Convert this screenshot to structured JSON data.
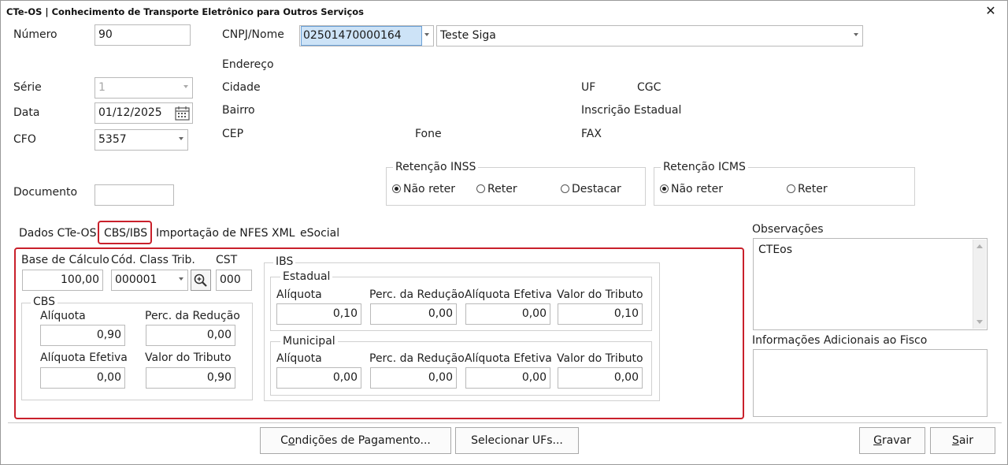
{
  "window": {
    "title": "CTe-OS | Conhecimento de Transporte Eletrônico para Outros Serviços",
    "close": "✕"
  },
  "header": {
    "numero_label": "Número",
    "numero_value": "90",
    "serie_label": "Série",
    "serie_value": "1",
    "data_label": "Data",
    "data_value": "01/12/2025",
    "cfo_label": "CFO",
    "cfo_value": "5357",
    "documento_label": "Documento",
    "documento_value": "",
    "cnpj_label": "CNPJ/Nome",
    "cnpj_value": "02501470000164",
    "nome_value": "Teste Siga",
    "endereco_label": "Endereço",
    "cidade_label": "Cidade",
    "bairro_label": "Bairro",
    "cep_label": "CEP",
    "fone_label": "Fone",
    "uf_label": "UF",
    "cgc_label": "CGC",
    "ie_label": "Inscrição Estadual",
    "fax_label": "FAX"
  },
  "retencao_inss": {
    "title": "Retenção INSS",
    "options": [
      "Não reter",
      "Reter",
      "Destacar"
    ],
    "selected": "Não reter"
  },
  "retencao_icms": {
    "title": "Retenção ICMS",
    "options": [
      "Não reter",
      "Reter"
    ],
    "selected": "Não reter"
  },
  "tabs": [
    "Dados CTe-OS",
    "CBS/IBS",
    "Importação de NFES XML",
    "eSocial"
  ],
  "active_tab": "CBS/IBS",
  "cbs_ibs": {
    "base_calculo_label": "Base de Cálculo",
    "base_calculo_value": "100,00",
    "cod_class_label": "Cód. Class Trib.",
    "cod_class_value": "000001",
    "cst_label": "CST",
    "cst_value": "000",
    "cbs": {
      "title": "CBS",
      "aliquota_label": "Alíquota",
      "aliquota_value": "0,90",
      "perc_reducao_label": "Perc. da Redução",
      "perc_reducao_value": "0,00",
      "aliquota_efetiva_label": "Alíquota Efetiva",
      "aliquota_efetiva_value": "0,00",
      "valor_tributo_label": "Valor do Tributo",
      "valor_tributo_value": "0,90"
    },
    "ibs": {
      "title": "IBS",
      "estadual": {
        "title": "Estadual",
        "aliquota_label": "Alíquota",
        "aliquota_value": "0,10",
        "perc_reducao_label": "Perc. da Redução",
        "perc_reducao_value": "0,00",
        "aliquota_efetiva_label": "Alíquota Efetiva",
        "aliquota_efetiva_value": "0,00",
        "valor_tributo_label": "Valor do Tributo",
        "valor_tributo_value": "0,10"
      },
      "municipal": {
        "title": "Municipal",
        "aliquota_label": "Alíquota",
        "aliquota_value": "0,00",
        "perc_reducao_label": "Perc. da Redução",
        "perc_reducao_value": "0,00",
        "aliquota_efetiva_label": "Alíquota Efetiva",
        "aliquota_efetiva_value": "0,00",
        "valor_tributo_label": "Valor do Tributo",
        "valor_tributo_value": "0,00"
      }
    }
  },
  "observacoes": {
    "label": "Observações",
    "value": "CTEos"
  },
  "info_fisco": {
    "label": "Informações Adicionais ao Fisco",
    "value": ""
  },
  "buttons": {
    "condicoes_pre": "C",
    "condicoes_u": "o",
    "condicoes_post": "ndições de Pagamento...",
    "selecionar": "Selecionar UFs...",
    "gravar_u": "G",
    "gravar_post": "ravar",
    "sair_u": "S",
    "sair_post": "air"
  },
  "colors": {
    "highlight_border": "#c9202b",
    "selection_bg": "#cde3f7"
  }
}
